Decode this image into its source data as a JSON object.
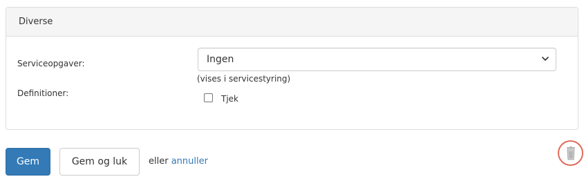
{
  "panel": {
    "title": "Diverse"
  },
  "form": {
    "service_label": "Serviceopgaver:",
    "service_select_value": "Ingen",
    "service_help": "(vises i servicestyring)",
    "definitions_label": "Definitioner:",
    "definitions_checkbox_label": "Tjek",
    "definitions_checked": false
  },
  "actions": {
    "save_label": "Gem",
    "save_close_label": "Gem og luk",
    "or_text": "eller",
    "cancel_label": "annuller"
  },
  "icons": {
    "select_chevron": "chevron-down-icon",
    "delete": "trash-icon"
  },
  "colors": {
    "primary": "#337ab7",
    "link": "#337ab7",
    "delete_circle": "#e06a5a",
    "panel_heading_bg": "#f5f5f5"
  }
}
